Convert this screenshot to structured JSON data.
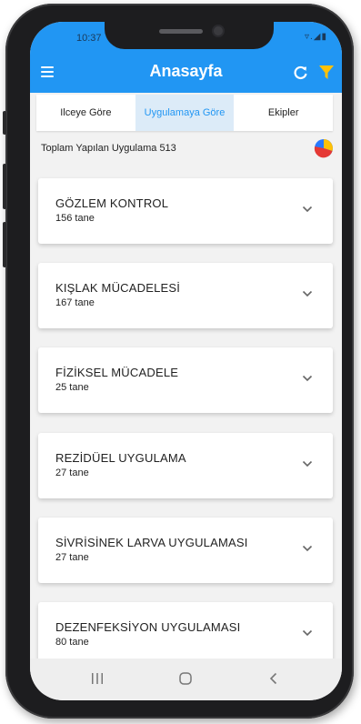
{
  "status": {
    "time": "10:37",
    "icons": "▿.◢▮"
  },
  "appbar": {
    "title": "Anasayfa",
    "menu_icon": "menu-icon",
    "refresh_icon": "refresh-icon",
    "filter_icon": "filter-icon"
  },
  "tabs": [
    {
      "label": "Ilceye Göre",
      "active": false
    },
    {
      "label": "Uygulamaya Göre",
      "active": true
    },
    {
      "label": "Ekipler",
      "active": false
    }
  ],
  "summary": {
    "label": "Toplam Yapılan Uygulama 513",
    "chart_icon": "pie-chart-icon"
  },
  "cards": [
    {
      "title": "GÖZLEM KONTROL",
      "count": "156 tane"
    },
    {
      "title": "KIŞLAK MÜCADELESİ",
      "count": "167 tane"
    },
    {
      "title": "FİZİKSEL MÜCADELE",
      "count": "25 tane"
    },
    {
      "title": "REZİDÜEL UYGULAMA",
      "count": "27 tane"
    },
    {
      "title": "SİVRİSİNEK LARVA UYGULAMASI",
      "count": "27 tane"
    },
    {
      "title": "DEZENFEKSİYON UYGULAMASI",
      "count": "80 tane"
    }
  ],
  "colors": {
    "primary": "#2196f3",
    "accent": "#ffc107",
    "active_tab_bg": "#dcebf8"
  },
  "navbar": {
    "recent_icon": "recent-apps-icon",
    "home_icon": "home-icon",
    "back_icon": "back-icon"
  }
}
